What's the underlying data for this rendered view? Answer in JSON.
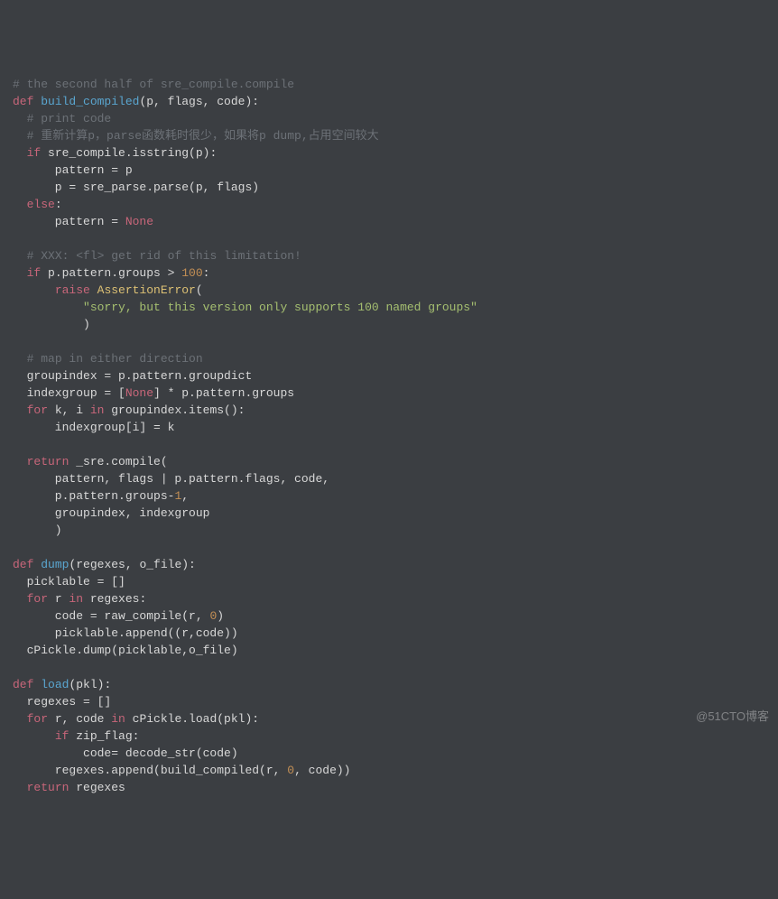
{
  "watermark": "@51CTO博客",
  "lines": [
    [
      [
        "c",
        "# the second half of sre_compile.compile"
      ]
    ],
    [
      [
        "kw",
        "def "
      ],
      [
        "fn",
        "build_compiled"
      ],
      [
        "op",
        "(p, flags, code):"
      ]
    ],
    [
      [
        "op",
        "  "
      ],
      [
        "c",
        "# print code"
      ]
    ],
    [
      [
        "op",
        "  "
      ],
      [
        "c",
        "# 重新计算p，parse函数耗时很少，如果将p dump,占用空间较大"
      ]
    ],
    [
      [
        "op",
        "  "
      ],
      [
        "kw",
        "if"
      ],
      [
        "op",
        " sre_compile.isstring(p):"
      ]
    ],
    [
      [
        "op",
        "      pattern = p"
      ]
    ],
    [
      [
        "op",
        "      p = sre_parse.parse(p, flags)"
      ]
    ],
    [
      [
        "op",
        "  "
      ],
      [
        "kw",
        "else"
      ],
      [
        "op",
        ":"
      ]
    ],
    [
      [
        "op",
        "      pattern = "
      ],
      [
        "nn",
        "None"
      ]
    ],
    [
      [
        "op",
        " "
      ]
    ],
    [
      [
        "op",
        "  "
      ],
      [
        "c",
        "# XXX: <fl> get rid of this limitation!"
      ]
    ],
    [
      [
        "op",
        "  "
      ],
      [
        "kw",
        "if"
      ],
      [
        "op",
        " p.pattern.groups > "
      ],
      [
        "num",
        "100"
      ],
      [
        "op",
        ":"
      ]
    ],
    [
      [
        "op",
        "      "
      ],
      [
        "kw",
        "raise"
      ],
      [
        "op",
        " "
      ],
      [
        "ye",
        "AssertionError"
      ],
      [
        "op",
        "("
      ]
    ],
    [
      [
        "op",
        "          "
      ],
      [
        "str",
        "\"sorry, but this version only supports 100 named groups\""
      ]
    ],
    [
      [
        "op",
        "          )"
      ]
    ],
    [
      [
        "op",
        " "
      ]
    ],
    [
      [
        "op",
        "  "
      ],
      [
        "c",
        "# map in either direction"
      ]
    ],
    [
      [
        "op",
        "  groupindex = p.pattern.groupdict"
      ]
    ],
    [
      [
        "op",
        "  indexgroup = ["
      ],
      [
        "nn",
        "None"
      ],
      [
        "op",
        "] * p.pattern.groups"
      ]
    ],
    [
      [
        "op",
        "  "
      ],
      [
        "kw",
        "for"
      ],
      [
        "op",
        " k, i "
      ],
      [
        "kw",
        "in"
      ],
      [
        "op",
        " groupindex.items():"
      ]
    ],
    [
      [
        "op",
        "      indexgroup[i] = k"
      ]
    ],
    [
      [
        "op",
        " "
      ]
    ],
    [
      [
        "op",
        "  "
      ],
      [
        "kw",
        "return"
      ],
      [
        "op",
        " _sre.compile("
      ]
    ],
    [
      [
        "op",
        "      pattern, flags | p.pattern.flags, code,"
      ]
    ],
    [
      [
        "op",
        "      p.pattern.groups"
      ],
      [
        "op",
        "-"
      ],
      [
        "num",
        "1"
      ],
      [
        "op",
        ","
      ]
    ],
    [
      [
        "op",
        "      groupindex, indexgroup"
      ]
    ],
    [
      [
        "op",
        "      )"
      ]
    ],
    [
      [
        "op",
        " "
      ]
    ],
    [
      [
        "kw",
        "def "
      ],
      [
        "fn",
        "dump"
      ],
      [
        "op",
        "(regexes, o_file):"
      ]
    ],
    [
      [
        "op",
        "  picklable = []"
      ]
    ],
    [
      [
        "op",
        "  "
      ],
      [
        "kw",
        "for"
      ],
      [
        "op",
        " r "
      ],
      [
        "kw",
        "in"
      ],
      [
        "op",
        " regexes:"
      ]
    ],
    [
      [
        "op",
        "      code = raw_compile(r, "
      ],
      [
        "num",
        "0"
      ],
      [
        "op",
        ")"
      ]
    ],
    [
      [
        "op",
        "      picklable.append((r,code))"
      ]
    ],
    [
      [
        "op",
        "  cPickle.dump(picklable,o_file)"
      ]
    ],
    [
      [
        "op",
        " "
      ]
    ],
    [
      [
        "kw",
        "def "
      ],
      [
        "fn",
        "load"
      ],
      [
        "op",
        "(pkl):"
      ]
    ],
    [
      [
        "op",
        "  regexes = []"
      ]
    ],
    [
      [
        "op",
        "  "
      ],
      [
        "kw",
        "for"
      ],
      [
        "op",
        " r, code "
      ],
      [
        "kw",
        "in"
      ],
      [
        "op",
        " cPickle.load(pkl):"
      ]
    ],
    [
      [
        "op",
        "      "
      ],
      [
        "kw",
        "if"
      ],
      [
        "op",
        " zip_flag:"
      ]
    ],
    [
      [
        "op",
        "          code= decode_str(code)"
      ]
    ],
    [
      [
        "op",
        "      regexes.append(build_compiled(r, "
      ],
      [
        "num",
        "0"
      ],
      [
        "op",
        ", code))"
      ]
    ],
    [
      [
        "op",
        "  "
      ],
      [
        "kw",
        "return"
      ],
      [
        "op",
        " regexes"
      ]
    ]
  ]
}
